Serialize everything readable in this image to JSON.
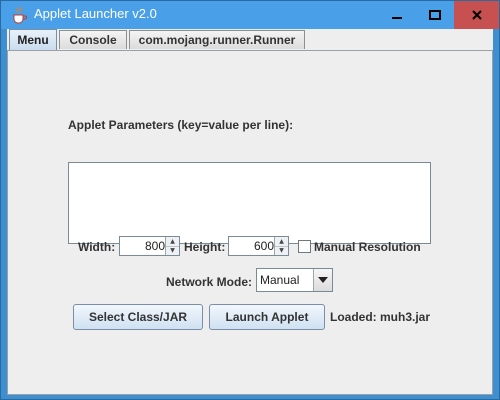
{
  "window": {
    "title": "Applet Launcher v2.0",
    "controls": {
      "minimize": "minimize-icon",
      "maximize": "maximize-icon",
      "close": "close-icon"
    }
  },
  "tabs": [
    {
      "label": "Menu",
      "active": true
    },
    {
      "label": "Console",
      "active": false
    },
    {
      "label": "com.mojang.runner.Runner",
      "active": false
    }
  ],
  "form": {
    "params_label": "Applet Parameters (key=value per line):",
    "params_value": "",
    "width_label": "Width:",
    "width_value": "800",
    "height_label": "Height:",
    "height_value": "600",
    "manual_resolution_label": "Manual Resolution",
    "manual_resolution_checked": false,
    "network_mode_label": "Network Mode:",
    "network_mode_value": "Manual",
    "select_button": "Select Class/JAR",
    "launch_button": "Launch Applet",
    "loaded_status": "Loaded: muh3.jar"
  },
  "colors": {
    "titlebar": "#4aa0e8",
    "close_button": "#c75050",
    "panel_bg": "#eeeeee"
  }
}
